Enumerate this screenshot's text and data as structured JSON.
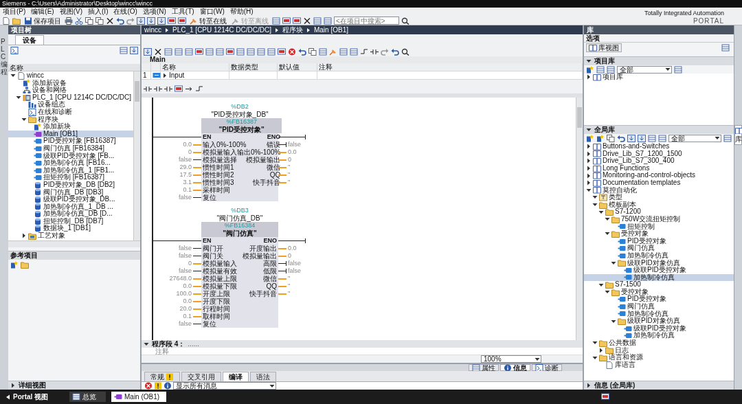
{
  "window": {
    "title": "Siemens  -  C:\\Users\\Administrator\\Desktop\\wincc\\wincc"
  },
  "menu": [
    "项目(P)",
    "编辑(E)",
    "视图(V)",
    "插入(I)",
    "在线(O)",
    "选项(N)",
    "工具(T)",
    "窗口(W)",
    "帮助(H)"
  ],
  "toolbar": {
    "save": "保存项目",
    "online": {
      "label": "转至在线",
      "disabled": false
    },
    "offline": {
      "label": "转至离线",
      "disabled": true
    },
    "search": {
      "placeholder": "<在项目中搜索>"
    }
  },
  "brand": {
    "line1": "Totally Integrated Automation",
    "line2": "PORTAL"
  },
  "side_strip": {
    "label": "PLC 编程"
  },
  "project_tree": {
    "title": "项目树",
    "tab": "设备",
    "column": "名称",
    "items": [
      {
        "label": "wincc",
        "kind": "project",
        "expanded": true,
        "selected": false,
        "children": [
          {
            "label": "添加新设备",
            "kind": "add",
            "selected": false
          },
          {
            "label": "设备和网络",
            "kind": "network",
            "selected": false
          },
          {
            "label": "PLC_1 [CPU 1214C DC/DC/DC]",
            "kind": "plc",
            "expanded": true,
            "selected": false,
            "children": [
              {
                "label": "设备组态",
                "kind": "config",
                "selected": false
              },
              {
                "label": "在线和诊断",
                "kind": "online",
                "selected": false
              },
              {
                "label": "程序块",
                "kind": "folder",
                "expanded": true,
                "selected": false,
                "children": [
                  {
                    "label": "添加新块",
                    "kind": "add",
                    "selected": false
                  },
                  {
                    "label": "Main [OB1]",
                    "kind": "ob",
                    "selected": true
                  },
                  {
                    "label": "PID受控对象 [FB16387]",
                    "kind": "fb",
                    "selected": false
                  },
                  {
                    "label": "阀门仿真 [FB16384]",
                    "kind": "fb",
                    "selected": false
                  },
                  {
                    "label": "级联PID受控对象 [FB...",
                    "kind": "fb",
                    "selected": false
                  },
                  {
                    "label": "加热制冷仿真 [FB16...",
                    "kind": "fb",
                    "selected": false
                  },
                  {
                    "label": "加热制冷仿真_1 [FB1...",
                    "kind": "fb",
                    "selected": false
                  },
                  {
                    "label": "扭矩控制 [FB16387]",
                    "kind": "fb",
                    "selected": false
                  },
                  {
                    "label": "PID受控对象_DB [DB2]",
                    "kind": "db",
                    "selected": false
                  },
                  {
                    "label": "阀门仿真_DB [DB3]",
                    "kind": "db",
                    "selected": false
                  },
                  {
                    "label": "级联PID受控对象_DB...",
                    "kind": "db",
                    "selected": false
                  },
                  {
                    "label": "加热制冷仿真_1_DB ...",
                    "kind": "db",
                    "selected": false
                  },
                  {
                    "label": "加热制冷仿真_DB [D...",
                    "kind": "db",
                    "selected": false
                  },
                  {
                    "label": "扭矩控制_DB [DB7]",
                    "kind": "db",
                    "selected": false
                  },
                  {
                    "label": "数据块_1 [DB1]",
                    "kind": "db",
                    "selected": false
                  }
                ]
              },
              {
                "label": "工艺对象",
                "kind": "tech",
                "expanded": false,
                "selected": false
              }
            ]
          }
        ]
      }
    ]
  },
  "reference_projects": {
    "title": "参考项目"
  },
  "details_view": {
    "title": "详细视图",
    "expanded": false
  },
  "editor": {
    "breadcrumb": [
      "wincc",
      "PLC_1 [CPU 1214C DC/DC/DC]",
      "程序块",
      "Main [OB1]"
    ],
    "block_name": "Main",
    "interface": {
      "columns": [
        "名称",
        "数据类型",
        "默认值",
        "注释"
      ],
      "rows": [
        {
          "index": "1",
          "name": "Input",
          "expanded": false
        }
      ]
    },
    "blocks": [
      {
        "instance_address": "%DB2",
        "instance_name": "\"PID受控对象_DB\"",
        "block_address": "%FB16387",
        "block_name": "\"PID受控对象\"",
        "en": "EN",
        "eno": "ENO",
        "inputs": [
          {
            "value": "0.0",
            "name": "输入0%-100%",
            "kind": "analog"
          },
          {
            "value": "0",
            "name": "模拟量输入",
            "kind": "analog"
          },
          {
            "value": "false",
            "name": "模拟量选择",
            "kind": "bool"
          },
          {
            "value": "29.0",
            "name": "惯性时间1",
            "kind": "analog"
          },
          {
            "value": "17.5",
            "name": "惯性时间2",
            "kind": "analog"
          },
          {
            "value": "3.1",
            "name": "惯性时间3",
            "kind": "analog"
          },
          {
            "value": "0.1",
            "name": "采样时间",
            "kind": "analog"
          },
          {
            "value": "false",
            "name": "复位",
            "kind": "bool"
          }
        ],
        "outputs": [
          {
            "name": "错误",
            "value": "false",
            "kind": "bool"
          },
          {
            "name": "输出0%-100%",
            "value": "0.0",
            "kind": "analog"
          },
          {
            "name": "模拟量输出",
            "value": "0",
            "kind": "analog"
          },
          {
            "name": "微信",
            "value": "''",
            "kind": "analog"
          },
          {
            "name": "QQ",
            "value": "''",
            "kind": "analog"
          },
          {
            "name": "快手抖音",
            "value": "''",
            "kind": "analog"
          }
        ]
      },
      {
        "instance_address": "%DB3",
        "instance_name": "\"阀门仿真_DB\"",
        "block_address": "%FB16384",
        "block_name": "\"阀门仿真\"",
        "en": "EN",
        "eno": "ENO",
        "inputs": [
          {
            "value": "false",
            "name": "阀门开",
            "kind": "bool"
          },
          {
            "value": "false",
            "name": "阀门关",
            "kind": "bool"
          },
          {
            "value": "0",
            "name": "模拟量输入",
            "kind": "analog"
          },
          {
            "value": "false",
            "name": "模拟量有效",
            "kind": "bool"
          },
          {
            "value": "27648.0",
            "name": "模拟量上限",
            "kind": "analog"
          },
          {
            "value": "0.0",
            "name": "模拟量下限",
            "kind": "analog"
          },
          {
            "value": "100.0",
            "name": "开度上限",
            "kind": "analog"
          },
          {
            "value": "0.0",
            "name": "开度下限",
            "kind": "analog"
          },
          {
            "value": "20.0",
            "name": "行程时间",
            "kind": "analog"
          },
          {
            "value": "0.1",
            "name": "取样时间",
            "kind": "analog"
          },
          {
            "value": "false",
            "name": "复位",
            "kind": "bool"
          }
        ],
        "outputs": [
          {
            "name": "开度输出",
            "value": "0.0",
            "kind": "analog"
          },
          {
            "name": "模拟量输出",
            "value": "0",
            "kind": "analog"
          },
          {
            "name": "高限",
            "value": "false",
            "kind": "bool"
          },
          {
            "name": "低限",
            "value": "false",
            "kind": "bool"
          },
          {
            "name": "微信",
            "value": "''",
            "kind": "analog"
          },
          {
            "name": "QQ",
            "value": "''",
            "kind": "analog"
          },
          {
            "name": "快手抖音",
            "value": "''",
            "kind": "analog"
          }
        ]
      }
    ],
    "network": {
      "label": "程序段 4：",
      "title": "......",
      "comment": "注释",
      "expanded": true
    },
    "zoom": "100%"
  },
  "inspector": {
    "side_tabs": [
      {
        "label": "属性",
        "selected": false
      },
      {
        "label": "信息",
        "selected": true
      },
      {
        "label": "诊断",
        "selected": false
      }
    ],
    "tabs": [
      {
        "label": "常规",
        "selected": false
      },
      {
        "label": "交叉引用",
        "selected": false
      },
      {
        "label": "编译",
        "selected": true
      },
      {
        "label": "语法",
        "selected": false
      }
    ],
    "filter": "显示所有消息"
  },
  "library": {
    "title": "库",
    "options": "选项",
    "view_button": "库视图",
    "project_library": {
      "title": "项目库",
      "expanded": true,
      "filter": "全部",
      "items": [
        {
          "label": "项目库",
          "kind": "book",
          "expanded": false,
          "selected": false
        }
      ]
    },
    "global_library": {
      "title": "全局库",
      "expanded": true,
      "filter": "全部",
      "items": [
        {
          "label": "Buttons-and-Switches",
          "kind": "library",
          "expanded": false,
          "selected": false
        },
        {
          "label": "Drive_Lib_S7_1200_1500",
          "kind": "library",
          "expanded": false,
          "selected": false
        },
        {
          "label": "Drive_Lib_S7_300_400",
          "kind": "library",
          "expanded": false,
          "selected": false
        },
        {
          "label": "Long Functions",
          "kind": "library",
          "expanded": false,
          "selected": false
        },
        {
          "label": "Monitoring-and-control-objects",
          "kind": "library",
          "expanded": false,
          "selected": false
        },
        {
          "label": "Documentation templates",
          "kind": "library",
          "expanded": false,
          "selected": false
        },
        {
          "label": "莫控自动化",
          "kind": "library",
          "expanded": true,
          "selected": false,
          "children": [
            {
              "label": "类型",
              "kind": "types",
              "expanded": true,
              "selected": false
            },
            {
              "label": "模板副本",
              "kind": "master",
              "expanded": true,
              "selected": false,
              "children": [
                {
                  "label": "S7-1200",
                  "kind": "folder",
                  "expanded": true,
                  "selected": false,
                  "children": [
                    {
                      "label": "750W交流扭矩控制",
                      "kind": "folder",
                      "expanded": true,
                      "selected": false,
                      "children": [
                        {
                          "label": "扭矩控制",
                          "kind": "block",
                          "selected": false
                        }
                      ]
                    },
                    {
                      "label": "受控对象",
                      "kind": "folder",
                      "expanded": true,
                      "selected": false,
                      "children": [
                        {
                          "label": "PID受控对象",
                          "kind": "block",
                          "selected": false
                        },
                        {
                          "label": "阀门仿真",
                          "kind": "block",
                          "selected": false
                        },
                        {
                          "label": "加热制冷仿真",
                          "kind": "block",
                          "selected": false
                        },
                        {
                          "label": "级联PID对象仿真",
                          "kind": "folder",
                          "expanded": true,
                          "selected": false,
                          "children": [
                            {
                              "label": "级联PID受控对象",
                              "kind": "block",
                              "selected": false
                            },
                            {
                              "label": "加热制冷仿真",
                              "kind": "block",
                              "selected": true
                            }
                          ]
                        }
                      ]
                    }
                  ]
                },
                {
                  "label": "S7-1500",
                  "kind": "folder",
                  "expanded": true,
                  "selected": false,
                  "children": [
                    {
                      "label": "受控对象",
                      "kind": "folder",
                      "expanded": true,
                      "selected": false,
                      "children": [
                        {
                          "label": "PID受控对象",
                          "kind": "block",
                          "selected": false
                        },
                        {
                          "label": "阀门仿真",
                          "kind": "block",
                          "selected": false
                        },
                        {
                          "label": "加热制冷仿真",
                          "kind": "block",
                          "selected": false
                        },
                        {
                          "label": "级联PID对象仿真",
                          "kind": "folder",
                          "expanded": true,
                          "selected": false,
                          "children": [
                            {
                              "label": "级联PID受控对象",
                              "kind": "block",
                              "selected": false
                            },
                            {
                              "label": "加热制冷仿真",
                              "kind": "block",
                              "selected": false
                            }
                          ]
                        }
                      ]
                    }
                  ]
                }
              ]
            },
            {
              "label": "公共数据",
              "kind": "common",
              "expanded": true,
              "selected": false,
              "children": [
                {
                  "label": "日志",
                  "kind": "folder",
                  "expanded": false,
                  "selected": false
                }
              ]
            },
            {
              "label": "语言和资源",
              "kind": "lang",
              "expanded": true,
              "selected": false,
              "children": [
                {
                  "label": "库语言",
                  "kind": "text",
                  "selected": false
                }
              ]
            }
          ]
        }
      ]
    }
  },
  "info_panel": {
    "title": "信息 (全局库)",
    "expanded": false
  },
  "right_tabs": [
    {
      "label": "库",
      "selected": true
    }
  ],
  "taskbar": {
    "portal": "Portal 视图",
    "overview": "总览",
    "editors": [
      {
        "label": "Main (OB1)",
        "selected": true
      }
    ]
  }
}
